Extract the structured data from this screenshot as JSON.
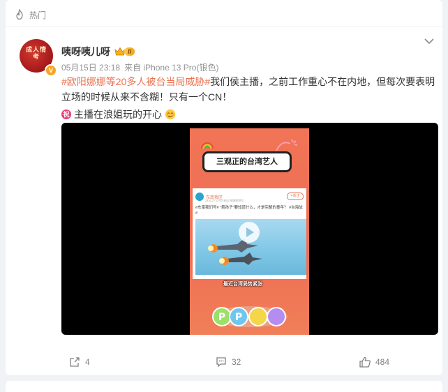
{
  "header": {
    "section_label": "热门"
  },
  "post": {
    "author": {
      "name": "咦呀咦儿呀",
      "avatar_text": "成人情考",
      "verified_mark": "V",
      "level_badge": "II"
    },
    "meta": {
      "date": "05月15日 23:18",
      "source": "来自 iPhone 13 Pro(银色)"
    },
    "text": {
      "hashtag": "#欧阳娜娜等20多人被台当局威胁#",
      "body_line1_rest": "我们侯主播，之前工作重心不在内地，但每次要表明",
      "body_line2": "立场的时候从来不含糊！只有一个CN！",
      "emoji_zhu": "祝",
      "line3": "主播在浪姐玩的开心"
    },
    "video": {
      "title_card": "三观正的台湾艺人",
      "embed_account": "东南我区",
      "embed_follow": "+关注",
      "embed_time": "24-5-22 22:00  来自 微博视频号",
      "embed_text": "#东南我们号# \"箭孩子\"要知道什么，才是完整的童年？ #台海战#",
      "subtitle": "最近台湾局势紧张",
      "logo_text": "PP娱乐"
    },
    "actions": {
      "share_count": "4",
      "comment_count": "32",
      "like_count": "484"
    }
  }
}
